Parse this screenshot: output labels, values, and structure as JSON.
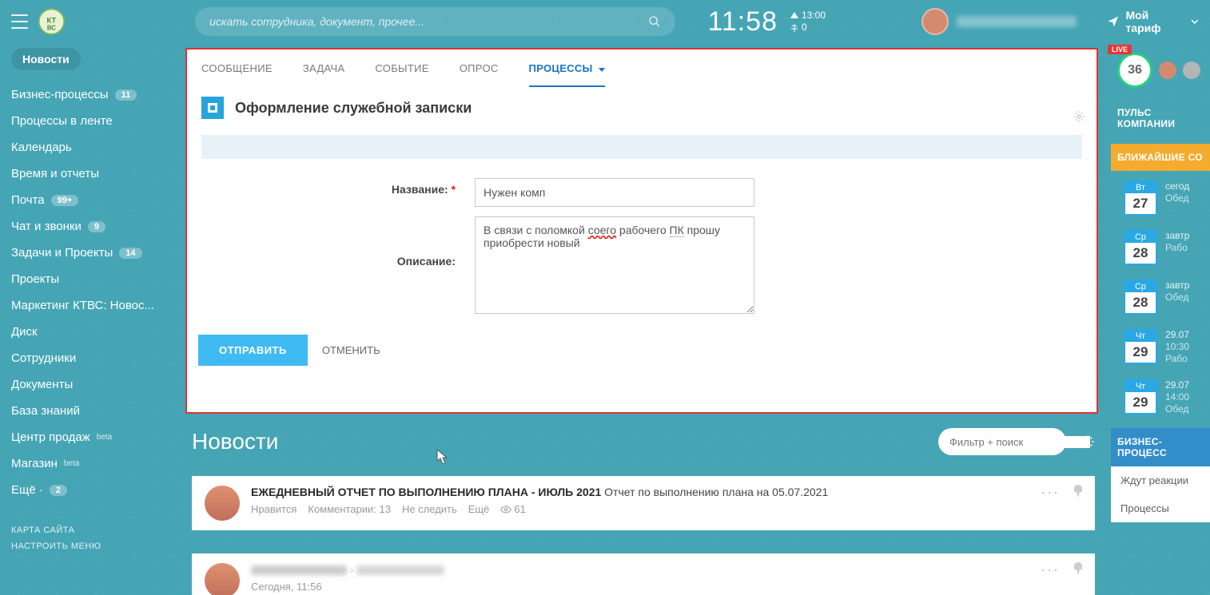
{
  "header": {
    "search_placeholder": "искать сотрудника, документ, прочее...",
    "clock": "11:58",
    "time_up": "13:00",
    "time_down": "0",
    "tariff_label": "Мой тариф"
  },
  "sidebar": {
    "active": "Новости",
    "items": [
      {
        "label": "Бизнес-процессы",
        "badge": "11"
      },
      {
        "label": "Процессы в ленте"
      },
      {
        "label": "Календарь"
      },
      {
        "label": "Время и отчеты"
      },
      {
        "label": "Почта",
        "badge": "99+"
      },
      {
        "label": "Чат и звонки",
        "badge": "9"
      },
      {
        "label": "Задачи и Проекты",
        "badge": "14"
      },
      {
        "label": "Проекты"
      },
      {
        "label": "Маркетинг КТВС: Новос..."
      },
      {
        "label": "Диск"
      },
      {
        "label": "Сотрудники"
      },
      {
        "label": "Документы"
      },
      {
        "label": "База знаний"
      },
      {
        "label": "Центр продаж",
        "beta": "beta"
      },
      {
        "label": "Магазин",
        "beta": "beta"
      },
      {
        "label": "Ещё ·",
        "badge": "2"
      }
    ],
    "footer": [
      "КАРТА САЙТА",
      "НАСТРОИТЬ МЕНЮ"
    ]
  },
  "form": {
    "tabs": [
      "СООБЩЕНИЕ",
      "ЗАДАЧА",
      "СОБЫТИЕ",
      "ОПРОС",
      "ПРОЦЕССЫ"
    ],
    "active_tab": 4,
    "title": "Оформление служебной записки",
    "label_name": "Название:",
    "value_name": "Нужен комп",
    "label_desc": "Описание:",
    "value_desc_pre": "В связи с поломкой ",
    "value_desc_err": "соего",
    "value_desc_mid": " рабочего ",
    "value_desc_dot": "ПК",
    "value_desc_post": " прошу приобрести новый",
    "btn_submit": "ОТПРАВИТЬ",
    "btn_cancel": "ОТМЕНИТЬ"
  },
  "news": {
    "heading": "Новости",
    "filter_placeholder": "Фильтр + поиск",
    "items": [
      {
        "title_bold": "ЕЖЕДНЕВНЫЙ ОТЧЕТ ПО ВЫПОЛНЕНИЮ ПЛАНА - ИЮЛЬ 2021",
        "title_rest": " Отчет по выполнению плана на 05.07.2021",
        "meta_like": "Нравится",
        "meta_comments": "Комментарии: 13",
        "meta_follow": "Не следить",
        "meta_more": "Ещё",
        "meta_views": "61"
      },
      {
        "timestamp": "Сегодня, 11:56"
      }
    ]
  },
  "rail": {
    "live_count": "36",
    "pulse_label": "ПУЛЬС КОМПАНИИ",
    "nearest_label": "БЛИЖАЙШИЕ СО",
    "days": [
      {
        "dow": "Вт",
        "num": "27",
        "l1": "сегод",
        "l2": "Обед"
      },
      {
        "dow": "Ср",
        "num": "28",
        "l1": "завтр",
        "l2": "Рабо"
      },
      {
        "dow": "Ср",
        "num": "28",
        "l1": "завтр",
        "l2": "Обед"
      },
      {
        "dow": "Чт",
        "num": "29",
        "l1": "29.07",
        "l2": "10:30",
        "l3": "Рабо"
      },
      {
        "dow": "Чт",
        "num": "29",
        "l1": "29.07",
        "l2": "14:00",
        "l3": "Обед"
      }
    ],
    "bp_header": "БИЗНЕС-ПРОЦЕСС",
    "bp_links": [
      "Ждут реакции",
      "Процессы"
    ]
  }
}
